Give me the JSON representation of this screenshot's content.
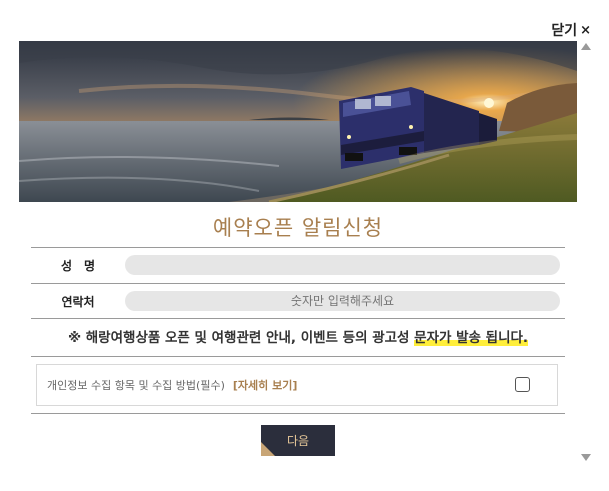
{
  "close": {
    "label": "닫기",
    "icon": "×"
  },
  "title": "예약오픈 알림신청",
  "form": {
    "name_label": "성　명",
    "phone_label": "연락처",
    "name_value": "",
    "phone_placeholder": "숫자만 입력해주세요"
  },
  "notice": {
    "prefix": "※ 해랑여행상품 오픈 및 여행관련 안내, 이벤트 등의 광고성 ",
    "highlight": "문자가 발송 됩니다."
  },
  "consent": {
    "text": "개인정보 수집 항목 및 수집 방법(필수)",
    "link": "[자세히 보기]",
    "checked": false
  },
  "next_button": "다음",
  "colors": {
    "accent": "#a87f4f",
    "button_bg": "#2b2e3c",
    "highlight": "#ffee3a"
  }
}
